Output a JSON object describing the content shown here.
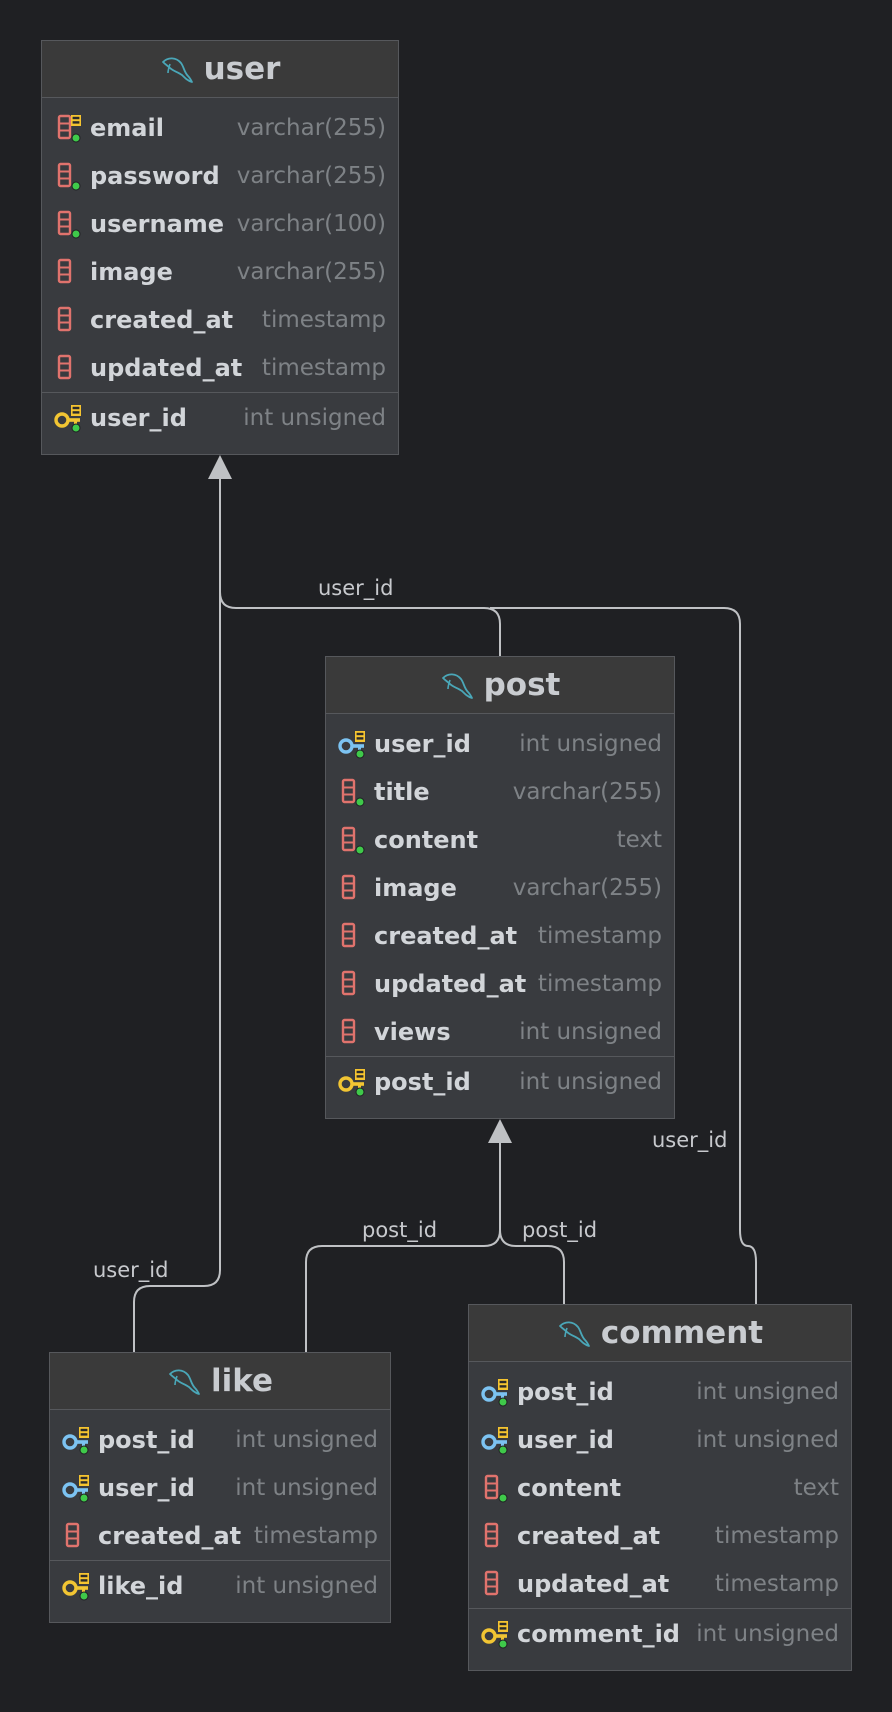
{
  "tables": {
    "user": {
      "name": "user",
      "columns": [
        {
          "name": "email",
          "type": "varchar(255)",
          "icon": "index-column-icon"
        },
        {
          "name": "password",
          "type": "varchar(255)",
          "icon": "column-notnull-icon"
        },
        {
          "name": "username",
          "type": "varchar(100)",
          "icon": "column-notnull-icon"
        },
        {
          "name": "image",
          "type": "varchar(255)",
          "icon": "column-icon"
        },
        {
          "name": "created_at",
          "type": "timestamp",
          "icon": "column-icon"
        },
        {
          "name": "updated_at",
          "type": "timestamp",
          "icon": "column-icon"
        }
      ],
      "pk": {
        "name": "user_id",
        "type": "int unsigned",
        "icon": "primary-key-icon"
      }
    },
    "post": {
      "name": "post",
      "columns": [
        {
          "name": "user_id",
          "type": "int unsigned",
          "icon": "foreign-key-icon"
        },
        {
          "name": "title",
          "type": "varchar(255)",
          "icon": "column-notnull-icon"
        },
        {
          "name": "content",
          "type": "text",
          "icon": "column-notnull-icon"
        },
        {
          "name": "image",
          "type": "varchar(255)",
          "icon": "column-icon"
        },
        {
          "name": "created_at",
          "type": "timestamp",
          "icon": "column-icon"
        },
        {
          "name": "updated_at",
          "type": "timestamp",
          "icon": "column-icon"
        },
        {
          "name": "views",
          "type": "int unsigned",
          "icon": "column-icon"
        }
      ],
      "pk": {
        "name": "post_id",
        "type": "int unsigned",
        "icon": "primary-key-icon"
      }
    },
    "like": {
      "name": "like",
      "columns": [
        {
          "name": "post_id",
          "type": "int unsigned",
          "icon": "foreign-key-icon"
        },
        {
          "name": "user_id",
          "type": "int unsigned",
          "icon": "foreign-key-icon"
        },
        {
          "name": "created_at",
          "type": "timestamp",
          "icon": "column-icon"
        }
      ],
      "pk": {
        "name": "like_id",
        "type": "int unsigned",
        "icon": "primary-key-icon"
      }
    },
    "comment": {
      "name": "comment",
      "columns": [
        {
          "name": "post_id",
          "type": "int unsigned",
          "icon": "foreign-key-icon"
        },
        {
          "name": "user_id",
          "type": "int unsigned",
          "icon": "foreign-key-icon"
        },
        {
          "name": "content",
          "type": "text",
          "icon": "column-notnull-icon"
        },
        {
          "name": "created_at",
          "type": "timestamp",
          "icon": "column-icon"
        },
        {
          "name": "updated_at",
          "type": "timestamp",
          "icon": "column-icon"
        }
      ],
      "pk": {
        "name": "comment_id",
        "type": "int unsigned",
        "icon": "primary-key-icon"
      }
    }
  },
  "relations": [
    {
      "from": "post",
      "to": "user",
      "label": "user_id"
    },
    {
      "from": "comment",
      "to": "user",
      "label": "user_id"
    },
    {
      "from": "like",
      "to": "user",
      "label": "user_id"
    },
    {
      "from": "like",
      "to": "post",
      "label": "post_id"
    },
    {
      "from": "comment",
      "to": "post",
      "label": "post_id"
    }
  ],
  "colors": {
    "background": "#1f2023",
    "table_body": "#393b3f",
    "table_header": "#3a3a3a",
    "border": "#56585c",
    "edge": "#bfc1c4",
    "column_icon": "#e0736d",
    "primary_key": "#f2c533",
    "foreign_key": "#7cc3f2",
    "not_null_dot": "#3fc94a",
    "db_icon": "#4aa7b8"
  }
}
